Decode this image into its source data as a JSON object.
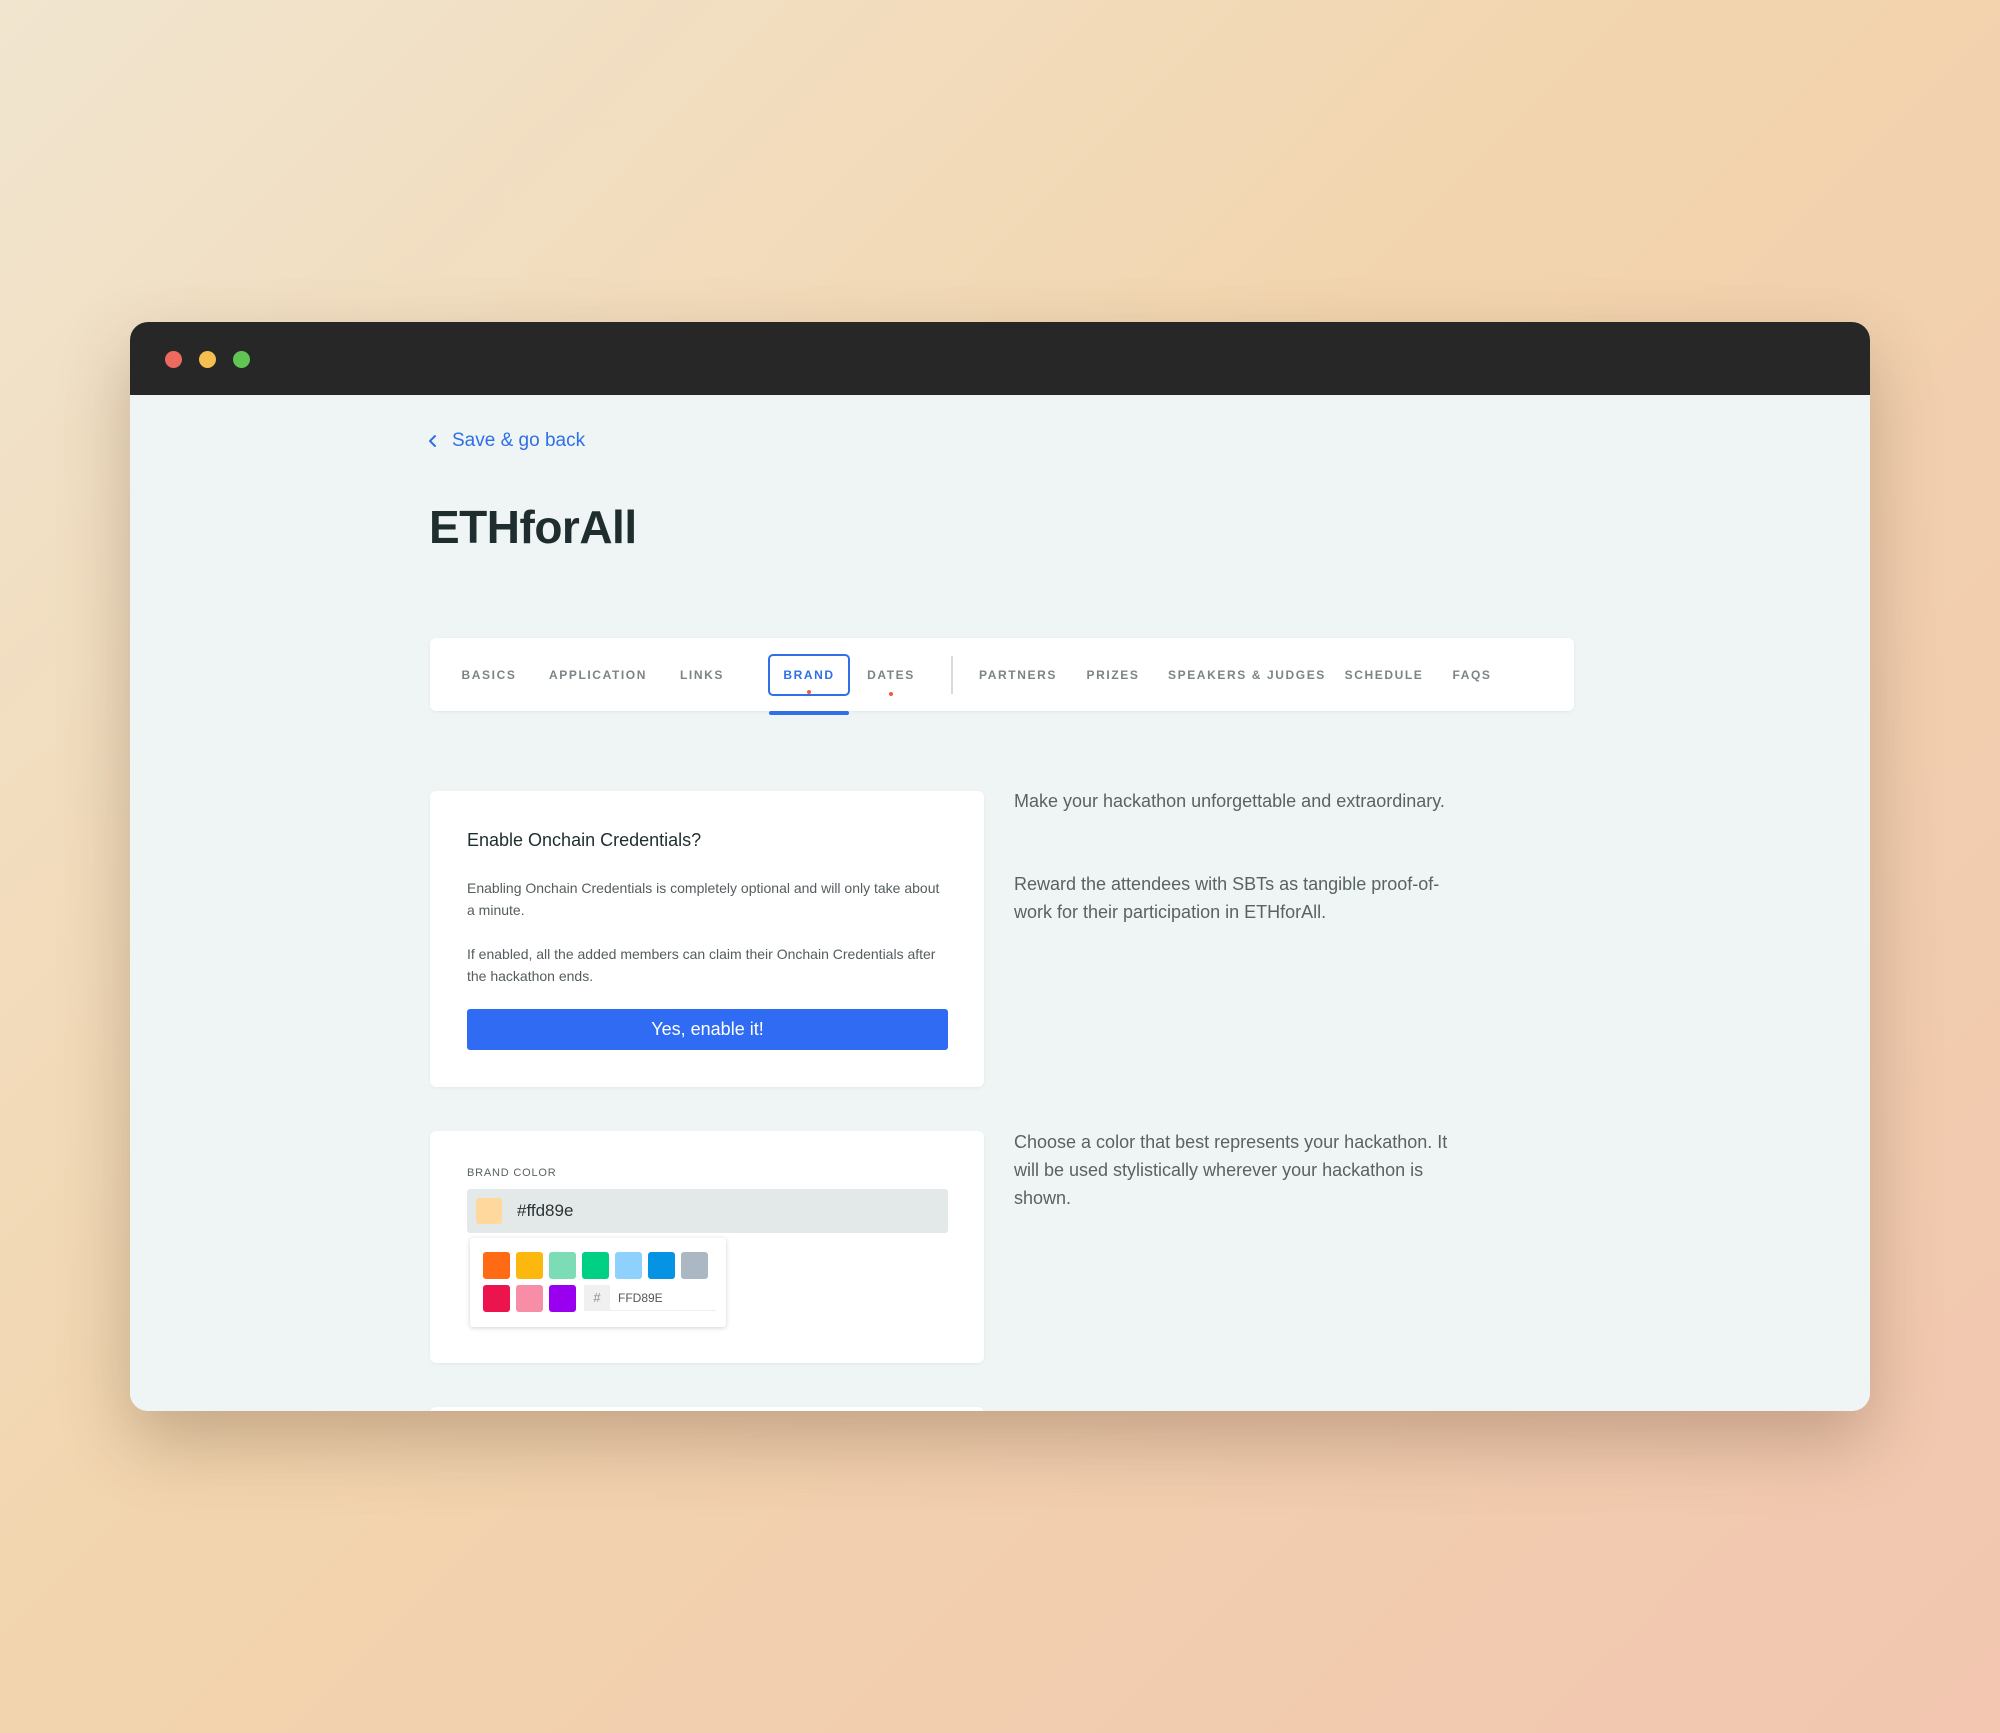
{
  "window": {
    "controls": [
      "close",
      "minimize",
      "maximize"
    ]
  },
  "back_link": {
    "label": "Save & go back",
    "icon": "chevron-left-icon"
  },
  "page_title": "ETHforAll",
  "tabs": [
    {
      "label": "BASICS",
      "active": false,
      "indicator": false
    },
    {
      "label": "APPLICATION",
      "active": false,
      "indicator": false
    },
    {
      "label": "LINKS",
      "active": false,
      "indicator": false
    },
    {
      "label": "BRAND",
      "active": true,
      "indicator": true
    },
    {
      "label": "DATES",
      "active": false,
      "indicator": true
    },
    {
      "label": "PARTNERS",
      "active": false,
      "indicator": false
    },
    {
      "label": "PRIZES",
      "active": false,
      "indicator": false
    },
    {
      "label": "SPEAKERS & JUDGES",
      "active": false,
      "indicator": false
    },
    {
      "label": "SCHEDULE",
      "active": false,
      "indicator": false
    },
    {
      "label": "FAQS",
      "active": false,
      "indicator": false
    }
  ],
  "onchain": {
    "title": "Enable Onchain Credentials?",
    "paragraph1": "Enabling Onchain Credentials is completely optional and will only take about a minute.",
    "paragraph2": "If enabled, all the added members can claim their Onchain Credentials after the hackathon ends.",
    "button_label": "Yes, enable it!",
    "side_text1": "Make your hackathon unforgettable and extraordinary.",
    "side_text2": "Reward the attendees with SBTs as tangible proof-of-work for their participation in ETHforAll."
  },
  "brand": {
    "label": "BRAND COLOR",
    "value": "#ffd89e",
    "picker": {
      "swatches": [
        "#ff6a14",
        "#fcb80f",
        "#7bdcb5",
        "#00d084",
        "#8ed1fc",
        "#0693e3",
        "#abb8c3",
        "#eb144c",
        "#f78da7",
        "#9900ef"
      ],
      "hash": "#",
      "hex_value": "FFD89E"
    },
    "side_text": "Choose a color that best represents your hackathon. It will be used stylistically wherever your hackathon is shown."
  },
  "colors": {
    "accent": "#2f6fe8",
    "button": "#2f6cf3",
    "indicator": "#ee5a3e",
    "selected_color": "#ffd89e"
  }
}
